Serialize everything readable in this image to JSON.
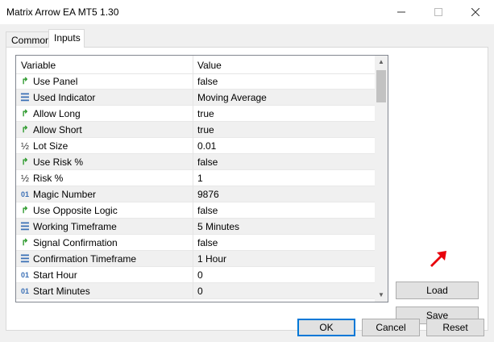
{
  "window": {
    "title": "Matrix Arrow EA MT5 1.30"
  },
  "tabs": [
    {
      "label": "Common"
    },
    {
      "label": "Inputs"
    }
  ],
  "grid": {
    "headers": {
      "variable": "Variable",
      "value": "Value"
    },
    "rows": [
      {
        "icon": "arrow",
        "name": "Use Panel",
        "value": "false"
      },
      {
        "icon": "list",
        "name": "Used Indicator",
        "value": "Moving Average"
      },
      {
        "icon": "arrow",
        "name": "Allow Long",
        "value": "true"
      },
      {
        "icon": "arrow",
        "name": "Allow Short",
        "value": "true"
      },
      {
        "icon": "frac",
        "name": "Lot Size",
        "value": "0.01"
      },
      {
        "icon": "arrow",
        "name": "Use Risk %",
        "value": "false"
      },
      {
        "icon": "frac",
        "name": "Risk %",
        "value": "1"
      },
      {
        "icon": "num",
        "name": "Magic Number",
        "value": "9876"
      },
      {
        "icon": "arrow",
        "name": "Use Opposite Logic",
        "value": "false"
      },
      {
        "icon": "list",
        "name": "Working Timeframe",
        "value": "5 Minutes"
      },
      {
        "icon": "arrow",
        "name": "Signal Confirmation",
        "value": "false"
      },
      {
        "icon": "list",
        "name": "Confirmation Timeframe",
        "value": "1 Hour"
      },
      {
        "icon": "num",
        "name": "Start Hour",
        "value": "0"
      },
      {
        "icon": "num",
        "name": "Start Minutes",
        "value": "0"
      }
    ]
  },
  "side_buttons": {
    "load": "Load",
    "save": "Save"
  },
  "footer_buttons": {
    "ok": "OK",
    "cancel": "Cancel",
    "reset": "Reset"
  },
  "icon_glyphs": {
    "arrow": "↱",
    "list": "☰",
    "frac": "½",
    "num": "01"
  },
  "colors": {
    "accent": "#0078d7",
    "annotation_arrow": "#e8000b"
  }
}
